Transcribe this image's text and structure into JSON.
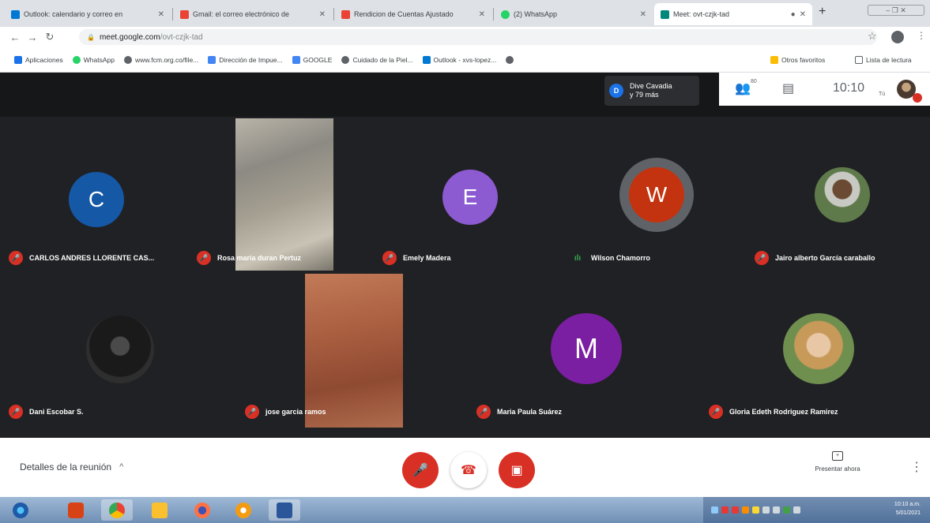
{
  "browser": {
    "tabs": [
      {
        "label": "Outlook: calendario y correo en",
        "active": false,
        "favicon_color": "#0078d4"
      },
      {
        "label": "Gmail: el correo electrónico de",
        "active": false,
        "favicon_color": "#ea4335"
      },
      {
        "label": "Rendicion de Cuentas Ajustado",
        "active": false,
        "favicon_color": "#ea4335"
      },
      {
        "label": "(2) WhatsApp",
        "active": false,
        "favicon_color": "#25d366"
      },
      {
        "label": "Meet: ovt-czjk-tad",
        "active": true,
        "favicon_color": "#00897b"
      }
    ],
    "address": {
      "host": "meet.google.com",
      "path": "/ovt-czjk-tad"
    },
    "bookmarks": [
      {
        "label": "Aplicaciones",
        "color": "#1a73e8"
      },
      {
        "label": "WhatsApp",
        "color": "#25d366"
      },
      {
        "label": "www.fcm.org.co/file...",
        "color": "#5f6368"
      },
      {
        "label": "Dirección de Impue...",
        "color": "#4285f4"
      },
      {
        "label": "GOOGLE",
        "color": "#4285f4"
      },
      {
        "label": "Cuidado de la Piel...",
        "color": "#5f6368"
      },
      {
        "label": "Outlook - xvs-lopez...",
        "color": "#0078d4"
      }
    ],
    "bookmarks_right": [
      "Otros favoritos",
      "Lista de lectura"
    ]
  },
  "meet": {
    "presenter": {
      "initial": "D",
      "name": "Dive Cavadia",
      "extra": "y 79 más"
    },
    "participants_count": "80",
    "time": "10:10",
    "self_label": "Tú",
    "tiles": [
      {
        "name": "CARLOS ANDRES LLORENTE CAS...",
        "initial": "C",
        "color": "#1558a6",
        "muted": true
      },
      {
        "name": "Rosa maria duran Pertuz",
        "muted": true,
        "video": true
      },
      {
        "name": "Emely Madera",
        "initial": "E",
        "color": "#8c5ad1",
        "muted": true
      },
      {
        "name": "Wilson Chamorro",
        "initial": "W",
        "color": "#c3330f",
        "muted": false,
        "speaking": true
      },
      {
        "name": "Jairo alberto García caraballo",
        "muted": true,
        "photo": true
      },
      {
        "name": "Dani Escobar S.",
        "muted": true,
        "photo": true
      },
      {
        "name": "jose garcia ramos",
        "muted": true,
        "video": true
      },
      {
        "name": "Maria Paula Suárez",
        "initial": "M",
        "color": "#7b1fa2",
        "muted": true
      },
      {
        "name": "Gloria Edeth Rodriguez Ramirez",
        "muted": true,
        "photo": true
      }
    ],
    "details_label": "Detalles de la reunión",
    "present_label": "Presentar ahora"
  },
  "taskbar": {
    "clock_time": "10:10 a.m.",
    "clock_date": "5/01/2021"
  }
}
